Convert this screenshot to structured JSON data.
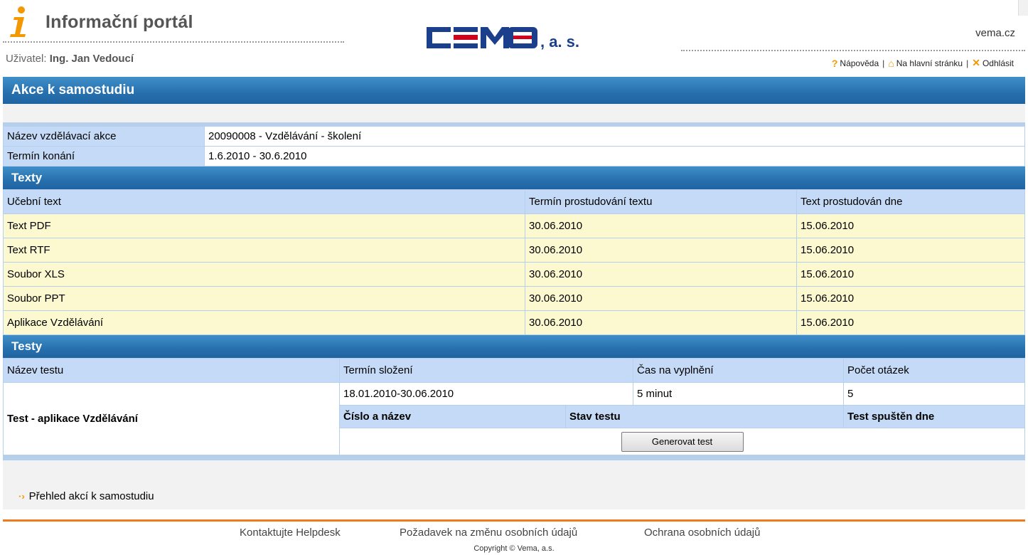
{
  "header": {
    "portal_title": "Informační portál",
    "user_label": "Uživatel:",
    "user_name": "Ing. Jan Vedoucí",
    "logo_text": "CEMO, a. s.",
    "site": "vema.cz",
    "links": {
      "help": "Nápověda",
      "home": "Na hlavní stránku",
      "logout": "Odhlásit"
    }
  },
  "page": {
    "title": "Akce k samostudiu"
  },
  "course": {
    "name_label": "Název vzdělávací akce",
    "name_value": "20090008 - Vzdělávání - školení",
    "date_label": "Termín konání",
    "date_value": "1.6.2010 - 30.6.2010"
  },
  "texts": {
    "section_title": "Texty",
    "columns": [
      "Učební text",
      "Termín prostudování textu",
      "Text prostudován dne"
    ],
    "rows": [
      [
        "Text PDF",
        "30.06.2010",
        "15.06.2010"
      ],
      [
        "Text RTF",
        "30.06.2010",
        "15.06.2010"
      ],
      [
        "Soubor XLS",
        "30.06.2010",
        "15.06.2010"
      ],
      [
        "Soubor PPT",
        "30.06.2010",
        "15.06.2010"
      ],
      [
        "Aplikace Vzdělávání",
        "30.06.2010",
        "15.06.2010"
      ]
    ]
  },
  "tests": {
    "section_title": "Testy",
    "columns": [
      "Název testu",
      "Termín složení",
      "Čas na vyplnění",
      "Počet otázek"
    ],
    "test_name": "Test - aplikace Vzdělávání",
    "term": "18.01.2010-30.06.2010",
    "time": "5 minut",
    "questions": "5",
    "sub_columns": [
      "Číslo a název",
      "Stav testu",
      "Test spuštěn dne"
    ],
    "generate_button": "Generovat test"
  },
  "back_link": "Přehled akcí k samostudiu",
  "footer": {
    "links": [
      "Kontaktujte Helpdesk",
      "Požadavek na změnu osobních údajů",
      "Ochrana osobních údajů"
    ],
    "copyright": "Copyright © Vema, a.s."
  },
  "colors": {
    "bar_blue": "#2770ad",
    "label_blue": "#c5daf6",
    "row_yellow": "#fcf8cf",
    "accent_orange": "#f39800",
    "footer_orange": "#f07a1e"
  }
}
